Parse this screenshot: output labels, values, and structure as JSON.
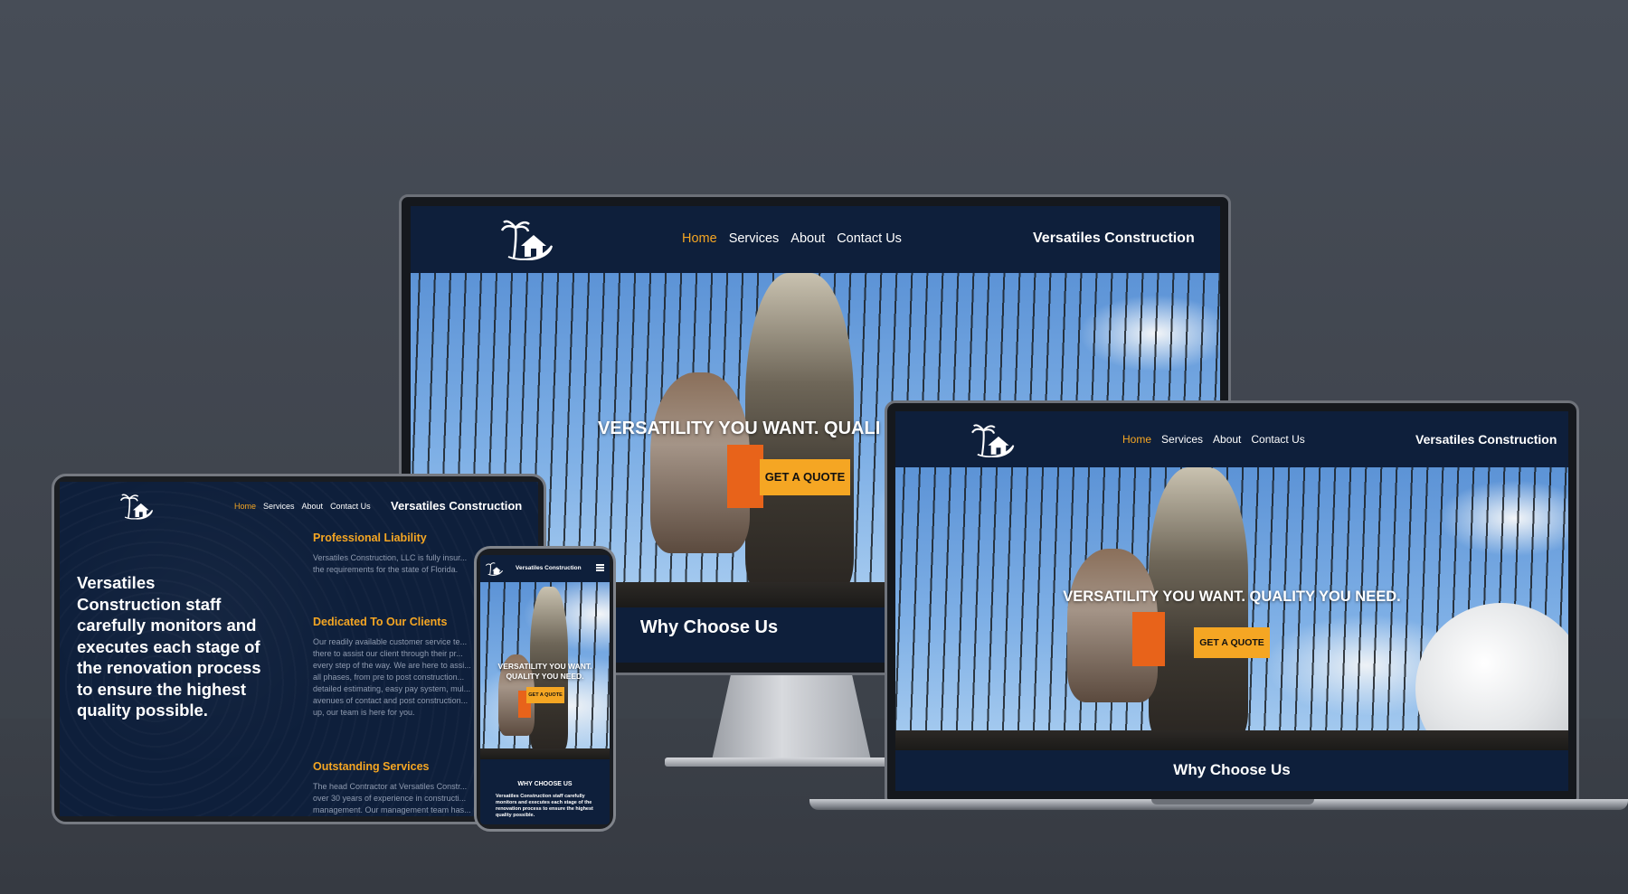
{
  "site": {
    "brand": "Versatiles Construction",
    "nav": [
      "Home",
      "Services",
      "About",
      "Contact Us"
    ],
    "hero_headline": "VERSATILITY YOU WANT. QUALITY YOU NEED.",
    "monitor_hero_visible": "VERSATILITY YOU WANT. QUALI",
    "phone_hero_line1": "VERSATILITY YOU WANT.",
    "phone_hero_line2": "QUALITY YOU NEED.",
    "cta": "GET A QUOTE",
    "why": "Why Choose Us",
    "why_upper": "WHY CHOOSE US"
  },
  "tablet": {
    "intro": "Versatiles Construction staff carefully monitors and executes each stage of the renovation process to ensure the highest quality possible.",
    "features": [
      {
        "title": "Professional Liability",
        "body": "Versatiles Construction, LLC is fully insur... the requirements for the state of Florida."
      },
      {
        "title": "Dedicated To Our Clients",
        "body": "Our readily available customer service te... there to assist our client through their pr... every step of the way. We are here to assi... all phases, from pre to post construction... detailed estimating, easy pay system, mul... avenues of contact and post construction... up, our team is here for you."
      },
      {
        "title": "Outstanding Services",
        "body": "The head Contractor at Versatiles Constr... over 30 years of experience in constructi... management. Our management team has..."
      }
    ]
  },
  "phone": {
    "intro": "Versatiles Construction staff carefully monitors and executes each stage of the renovation process to ensure the highest quality possible."
  },
  "colors": {
    "navy": "#0e1f3b",
    "accent": "#f5a623",
    "background": "#444a54"
  },
  "icons": {
    "logo": "palm-house-logo-icon",
    "menu": "hamburger-menu-icon"
  }
}
